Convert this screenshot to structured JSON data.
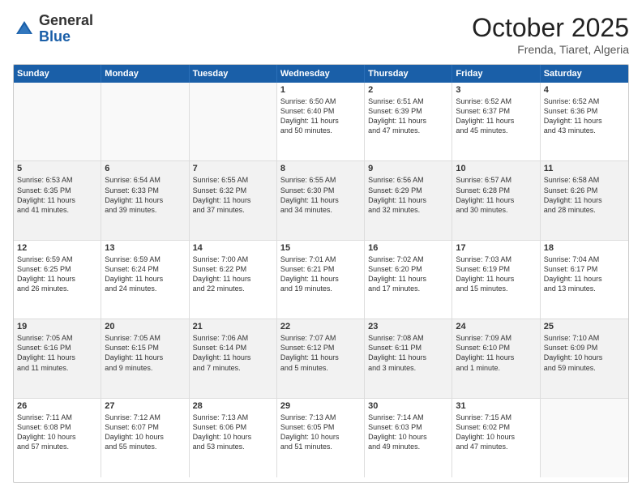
{
  "logo": {
    "general": "General",
    "blue": "Blue"
  },
  "header": {
    "month": "October 2025",
    "location": "Frenda, Tiaret, Algeria"
  },
  "weekdays": [
    "Sunday",
    "Monday",
    "Tuesday",
    "Wednesday",
    "Thursday",
    "Friday",
    "Saturday"
  ],
  "rows": [
    [
      {
        "day": "",
        "info": ""
      },
      {
        "day": "",
        "info": ""
      },
      {
        "day": "",
        "info": ""
      },
      {
        "day": "1",
        "info": "Sunrise: 6:50 AM\nSunset: 6:40 PM\nDaylight: 11 hours\nand 50 minutes."
      },
      {
        "day": "2",
        "info": "Sunrise: 6:51 AM\nSunset: 6:39 PM\nDaylight: 11 hours\nand 47 minutes."
      },
      {
        "day": "3",
        "info": "Sunrise: 6:52 AM\nSunset: 6:37 PM\nDaylight: 11 hours\nand 45 minutes."
      },
      {
        "day": "4",
        "info": "Sunrise: 6:52 AM\nSunset: 6:36 PM\nDaylight: 11 hours\nand 43 minutes."
      }
    ],
    [
      {
        "day": "5",
        "info": "Sunrise: 6:53 AM\nSunset: 6:35 PM\nDaylight: 11 hours\nand 41 minutes."
      },
      {
        "day": "6",
        "info": "Sunrise: 6:54 AM\nSunset: 6:33 PM\nDaylight: 11 hours\nand 39 minutes."
      },
      {
        "day": "7",
        "info": "Sunrise: 6:55 AM\nSunset: 6:32 PM\nDaylight: 11 hours\nand 37 minutes."
      },
      {
        "day": "8",
        "info": "Sunrise: 6:55 AM\nSunset: 6:30 PM\nDaylight: 11 hours\nand 34 minutes."
      },
      {
        "day": "9",
        "info": "Sunrise: 6:56 AM\nSunset: 6:29 PM\nDaylight: 11 hours\nand 32 minutes."
      },
      {
        "day": "10",
        "info": "Sunrise: 6:57 AM\nSunset: 6:28 PM\nDaylight: 11 hours\nand 30 minutes."
      },
      {
        "day": "11",
        "info": "Sunrise: 6:58 AM\nSunset: 6:26 PM\nDaylight: 11 hours\nand 28 minutes."
      }
    ],
    [
      {
        "day": "12",
        "info": "Sunrise: 6:59 AM\nSunset: 6:25 PM\nDaylight: 11 hours\nand 26 minutes."
      },
      {
        "day": "13",
        "info": "Sunrise: 6:59 AM\nSunset: 6:24 PM\nDaylight: 11 hours\nand 24 minutes."
      },
      {
        "day": "14",
        "info": "Sunrise: 7:00 AM\nSunset: 6:22 PM\nDaylight: 11 hours\nand 22 minutes."
      },
      {
        "day": "15",
        "info": "Sunrise: 7:01 AM\nSunset: 6:21 PM\nDaylight: 11 hours\nand 19 minutes."
      },
      {
        "day": "16",
        "info": "Sunrise: 7:02 AM\nSunset: 6:20 PM\nDaylight: 11 hours\nand 17 minutes."
      },
      {
        "day": "17",
        "info": "Sunrise: 7:03 AM\nSunset: 6:19 PM\nDaylight: 11 hours\nand 15 minutes."
      },
      {
        "day": "18",
        "info": "Sunrise: 7:04 AM\nSunset: 6:17 PM\nDaylight: 11 hours\nand 13 minutes."
      }
    ],
    [
      {
        "day": "19",
        "info": "Sunrise: 7:05 AM\nSunset: 6:16 PM\nDaylight: 11 hours\nand 11 minutes."
      },
      {
        "day": "20",
        "info": "Sunrise: 7:05 AM\nSunset: 6:15 PM\nDaylight: 11 hours\nand 9 minutes."
      },
      {
        "day": "21",
        "info": "Sunrise: 7:06 AM\nSunset: 6:14 PM\nDaylight: 11 hours\nand 7 minutes."
      },
      {
        "day": "22",
        "info": "Sunrise: 7:07 AM\nSunset: 6:12 PM\nDaylight: 11 hours\nand 5 minutes."
      },
      {
        "day": "23",
        "info": "Sunrise: 7:08 AM\nSunset: 6:11 PM\nDaylight: 11 hours\nand 3 minutes."
      },
      {
        "day": "24",
        "info": "Sunrise: 7:09 AM\nSunset: 6:10 PM\nDaylight: 11 hours\nand 1 minute."
      },
      {
        "day": "25",
        "info": "Sunrise: 7:10 AM\nSunset: 6:09 PM\nDaylight: 10 hours\nand 59 minutes."
      }
    ],
    [
      {
        "day": "26",
        "info": "Sunrise: 7:11 AM\nSunset: 6:08 PM\nDaylight: 10 hours\nand 57 minutes."
      },
      {
        "day": "27",
        "info": "Sunrise: 7:12 AM\nSunset: 6:07 PM\nDaylight: 10 hours\nand 55 minutes."
      },
      {
        "day": "28",
        "info": "Sunrise: 7:13 AM\nSunset: 6:06 PM\nDaylight: 10 hours\nand 53 minutes."
      },
      {
        "day": "29",
        "info": "Sunrise: 7:13 AM\nSunset: 6:05 PM\nDaylight: 10 hours\nand 51 minutes."
      },
      {
        "day": "30",
        "info": "Sunrise: 7:14 AM\nSunset: 6:03 PM\nDaylight: 10 hours\nand 49 minutes."
      },
      {
        "day": "31",
        "info": "Sunrise: 7:15 AM\nSunset: 6:02 PM\nDaylight: 10 hours\nand 47 minutes."
      },
      {
        "day": "",
        "info": ""
      }
    ]
  ]
}
